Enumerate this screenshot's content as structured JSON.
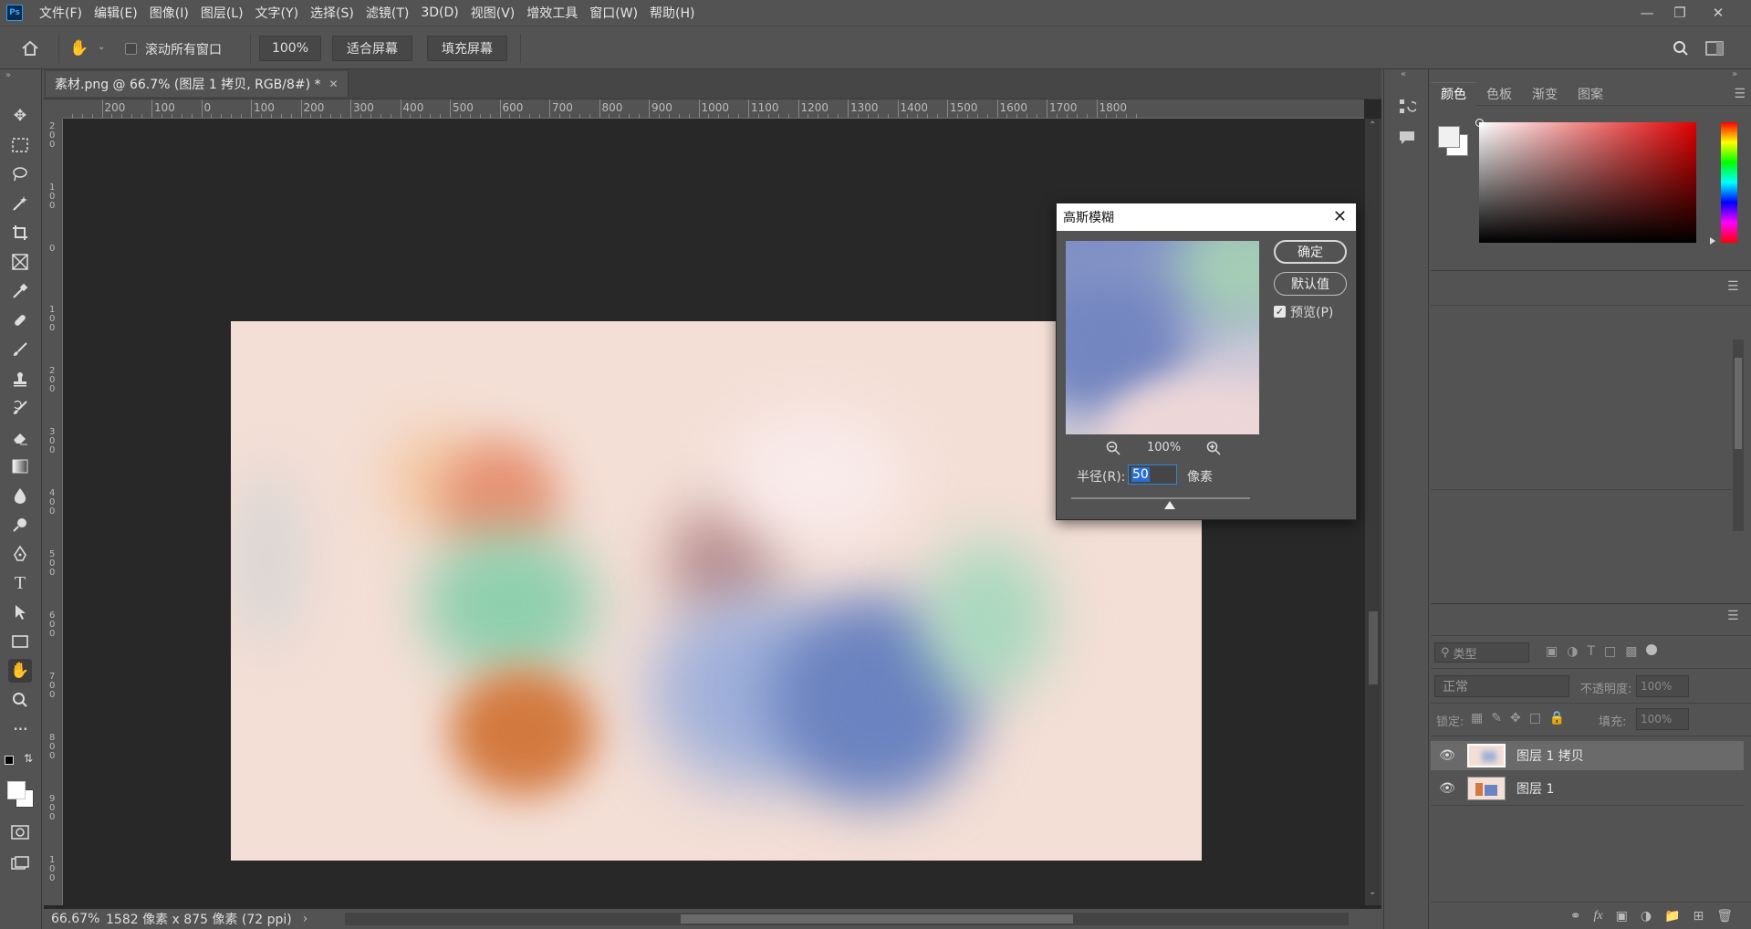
{
  "menu": {
    "items": [
      "文件(F)",
      "编辑(E)",
      "图像(I)",
      "图层(L)",
      "文字(Y)",
      "选择(S)",
      "滤镜(T)",
      "3D(D)",
      "视图(V)",
      "增效工具",
      "窗口(W)",
      "帮助(H)"
    ]
  },
  "options": {
    "scroll_all": "滚动所有窗口",
    "zoom": "100%",
    "fit_screen": "适合屏幕",
    "fill_screen": "填充屏幕"
  },
  "document": {
    "tab_title": "素材.png @ 66.7% (图层 1 拷贝, RGB/8#) *",
    "ruler_h": [
      "0",
      "200",
      "100",
      "0",
      "100",
      "200",
      "300",
      "400",
      "500",
      "600",
      "700",
      "800",
      "900",
      "1000",
      "1100",
      "1200",
      "1300",
      "1400",
      "1500",
      "1600",
      "1700",
      "1800"
    ],
    "ruler_v": [
      "2\n0\n0",
      "1\n0\n0",
      "0",
      "1\n0\n0",
      "2\n0\n0",
      "3\n0\n0",
      "4\n0\n0",
      "5\n0\n0",
      "6\n0\n0",
      "7\n0\n0",
      "8\n0\n0",
      "9\n0\n0",
      "1\n0\n0"
    ]
  },
  "status": {
    "zoom": "66.67%",
    "info": "1582 像素 x 875 像素 (72 ppi)"
  },
  "color_panel": {
    "tabs": [
      "颜色",
      "色板",
      "渐变",
      "图案"
    ]
  },
  "layers_panel": {
    "filter_placeholder": "类型",
    "blend_mode": "正常",
    "opacity_label": "不透明度:",
    "opacity_value": "100%",
    "lock_label": "锁定:",
    "fill_label": "填充:",
    "fill_value": "100%",
    "layers": [
      {
        "name": "图层 1 拷贝",
        "selected": true
      },
      {
        "name": "图层 1",
        "selected": false
      }
    ]
  },
  "dialog": {
    "title": "高斯模糊",
    "ok": "确定",
    "default": "默认值",
    "preview_label": "预览(P)",
    "preview_checked": true,
    "preview_zoom": "100%",
    "radius_label": "半径(R):",
    "radius_value": "50",
    "unit": "像素"
  },
  "colors": {
    "canvas_bg": "#f4dfd6",
    "accent": "#31a8ff"
  }
}
